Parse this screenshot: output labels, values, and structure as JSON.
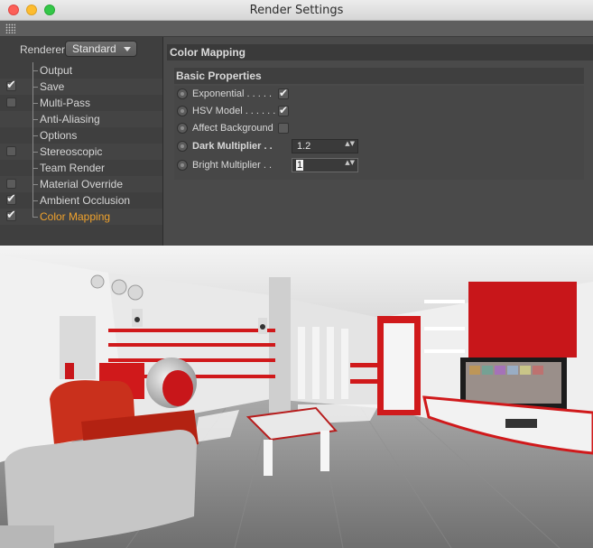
{
  "window": {
    "title": "Render Settings"
  },
  "renderer": {
    "label": "Renderer",
    "value": "Standard"
  },
  "tree": [
    {
      "label": "Output",
      "checkbox": false,
      "checked": false
    },
    {
      "label": "Save",
      "checkbox": true,
      "checked": true
    },
    {
      "label": "Multi-Pass",
      "checkbox": true,
      "checked": false
    },
    {
      "label": "Anti-Aliasing",
      "checkbox": false,
      "checked": false
    },
    {
      "label": "Options",
      "checkbox": false,
      "checked": false
    },
    {
      "label": "Stereoscopic",
      "checkbox": true,
      "checked": false
    },
    {
      "label": "Team Render",
      "checkbox": false,
      "checked": false
    },
    {
      "label": "Material Override",
      "checkbox": true,
      "checked": false
    },
    {
      "label": "Ambient Occlusion",
      "checkbox": true,
      "checked": true
    },
    {
      "label": "Color Mapping",
      "checkbox": true,
      "checked": true,
      "active": true
    }
  ],
  "panel": {
    "title": "Color Mapping",
    "group": "Basic Properties",
    "params": {
      "exponential": {
        "label": "Exponential . . . . .",
        "checked": true
      },
      "hsv_model": {
        "label": "HSV Model . . . . . .",
        "checked": true
      },
      "affect_background": {
        "label": "Affect Background",
        "checked": false
      },
      "dark_multiplier": {
        "label": "Dark Multiplier . .",
        "value": "1.2"
      },
      "bright_multiplier": {
        "label": "Bright Multiplier . .",
        "value": "1"
      }
    }
  },
  "marks": {
    "check": "✔",
    "spin": "▲▼"
  },
  "colors": {
    "active": "#f0a22c",
    "accent_red": "#c8161a"
  }
}
